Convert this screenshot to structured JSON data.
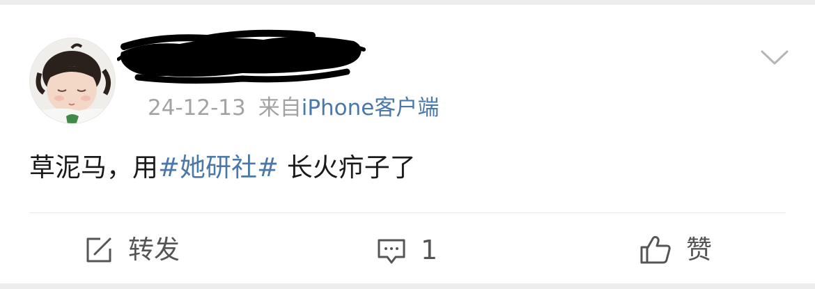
{
  "post": {
    "meta": {
      "date": "24-12-13",
      "source_prefix": "来自",
      "source": "iPhone客户端"
    },
    "content": {
      "text_before": "草泥马，用",
      "topic": "#她研社#",
      "text_after": " 长火疖子了"
    },
    "actions": {
      "repost_label": "转发",
      "comment_count": "1",
      "like_label": "赞"
    },
    "icons": {
      "menu": "chevron-down-icon",
      "repost": "share-edit-icon",
      "comment": "comment-icon",
      "like": "thumbs-up-icon"
    }
  },
  "colors": {
    "link": "#4a78ab",
    "text": "#1a1a1a",
    "meta": "#a3a3a3",
    "action": "#555555",
    "background": "#ededed"
  }
}
